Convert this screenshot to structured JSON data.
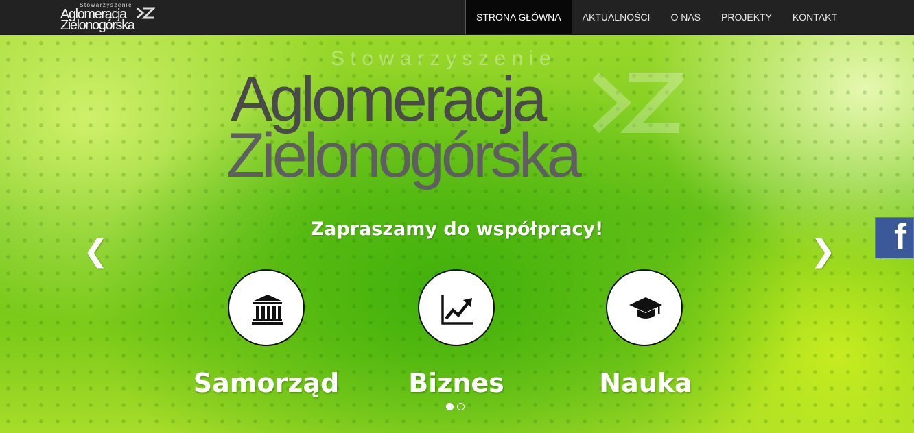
{
  "brand": {
    "small": "Stowarzyszenie",
    "line1": "Aglomeracja",
    "line2": "Zielonogórska"
  },
  "nav": {
    "items": [
      {
        "label": "STRONA GŁÓWNA",
        "active": true
      },
      {
        "label": "AKTUALNOŚCI",
        "active": false
      },
      {
        "label": "O NAS",
        "active": false
      },
      {
        "label": "PROJEKTY",
        "active": false
      },
      {
        "label": "KONTAKT",
        "active": false
      }
    ]
  },
  "hero": {
    "logo_small": "Stowarzyszenie",
    "logo_line1": "Aglomeracja",
    "logo_line2": "Zielonogórska",
    "tagline": "Zapraszamy do współpracy!",
    "prev": "❮",
    "next": "❯",
    "categories": [
      {
        "label": "Samorząd",
        "icon": "institution-icon"
      },
      {
        "label": "Biznes",
        "icon": "line-chart-icon"
      },
      {
        "label": "Nauka",
        "icon": "graduation-cap-icon"
      }
    ],
    "slides": {
      "count": 2,
      "active": 1
    }
  },
  "social": {
    "facebook": "f"
  },
  "colors": {
    "navbar": "#222222",
    "active_tab": "#080808",
    "hero_green": "#6cc41a",
    "facebook": "#3b5998"
  }
}
